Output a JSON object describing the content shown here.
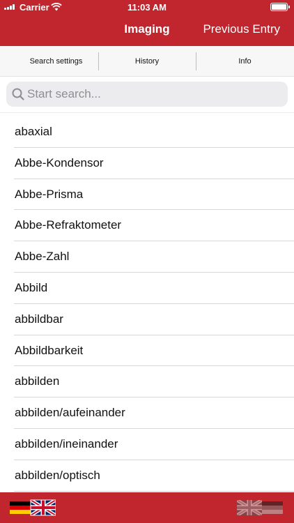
{
  "status_bar": {
    "carrier": "Carrier",
    "time": "11:03 AM"
  },
  "nav": {
    "title": "Imaging",
    "right_button": "Previous Entry"
  },
  "segments": [
    "Search settings",
    "History",
    "Info"
  ],
  "search": {
    "placeholder": "Start search..."
  },
  "entries": [
    "abaxial",
    "Abbe-Kondensor",
    "Abbe-Prisma",
    "Abbe-Refraktometer",
    "Abbe-Zahl",
    "Abbild",
    "abbildbar",
    "Abbildbarkeit",
    "abbilden",
    "abbilden/aufeinander",
    "abbilden/ineinander",
    "abbilden/optisch"
  ],
  "bottom_bar": {
    "left_icon": "german-to-english-flag-icon",
    "right_icon": "english-to-german-flag-icon"
  },
  "colors": {
    "brand_red": "#c1262e",
    "segment_bg": "#f7f7f7",
    "search_field_bg": "#ececee"
  }
}
